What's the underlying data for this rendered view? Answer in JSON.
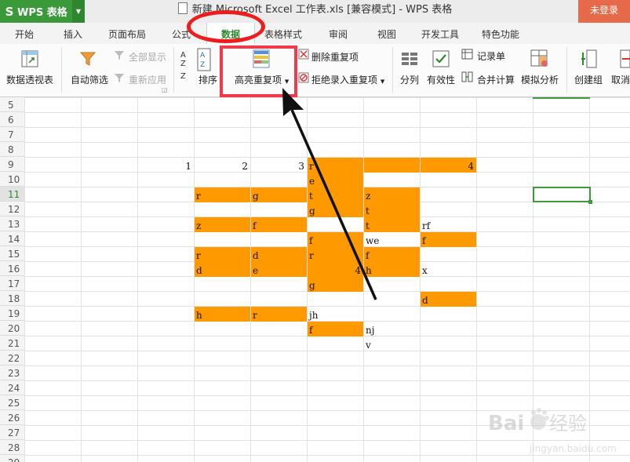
{
  "window": {
    "app_name": "WPS 表格",
    "doc_title": "新建 Microsoft Excel 工作表.xls [兼容模式] - WPS 表格",
    "login_label": "未登录"
  },
  "tabs": [
    {
      "label": "开始"
    },
    {
      "label": "插入"
    },
    {
      "label": "页面布局"
    },
    {
      "label": "公式"
    },
    {
      "label": "数据",
      "active": true
    },
    {
      "label": "表格样式"
    },
    {
      "label": "审阅"
    },
    {
      "label": "视图"
    },
    {
      "label": "开发工具"
    },
    {
      "label": "特色功能"
    }
  ],
  "ribbon": {
    "pivot": "数据透视表",
    "autofilter": "自动筛选",
    "show_all": "全部显示",
    "reapply": "重新应用",
    "sort": "排序",
    "highlight_dup": "高亮重复项",
    "delete_dup": "删除重复项",
    "reject_dup": "拒绝录入重复项",
    "split": "分列",
    "validity": "有效性",
    "record": "记录单",
    "consolidate": "合并计算",
    "simulate": "模拟分析",
    "create_group": "创建组",
    "cancel_group": "取消"
  },
  "colors": {
    "accent": "#2c8a2c",
    "fill": "#ff9900",
    "annotation_red": "#ee1c1c"
  },
  "rows": [
    "5",
    "6",
    "7",
    "8",
    "9",
    "10",
    "11",
    "12",
    "13",
    "14",
    "15",
    "16",
    "17",
    "18",
    "19",
    "20",
    "21",
    "22",
    "23",
    "24",
    "25",
    "26",
    "27",
    "28",
    "29"
  ],
  "cells": [
    {
      "r": 9,
      "c": 2,
      "v": "1",
      "align": "right"
    },
    {
      "r": 9,
      "c": 3,
      "v": "2",
      "align": "right"
    },
    {
      "r": 9,
      "c": 4,
      "v": "3",
      "align": "right"
    },
    {
      "r": 9,
      "c": 5,
      "v": "r",
      "fill": true
    },
    {
      "r": 9,
      "c": 6,
      "v": "",
      "fill": true
    },
    {
      "r": 9,
      "c": 7,
      "v": "4",
      "align": "right",
      "fill": true
    },
    {
      "r": 10,
      "c": 5,
      "v": "e",
      "fill": true
    },
    {
      "r": 11,
      "c": 3,
      "v": "r",
      "fill": true
    },
    {
      "r": 11,
      "c": 4,
      "v": "g",
      "fill": true
    },
    {
      "r": 11,
      "c": 5,
      "v": "t",
      "fill": true
    },
    {
      "r": 11,
      "c": 6,
      "v": "z",
      "fill": true
    },
    {
      "r": 12,
      "c": 5,
      "v": "g",
      "fill": true
    },
    {
      "r": 12,
      "c": 6,
      "v": "t",
      "fill": true
    },
    {
      "r": 13,
      "c": 3,
      "v": "z",
      "fill": true
    },
    {
      "r": 13,
      "c": 4,
      "v": "f",
      "fill": true
    },
    {
      "r": 13,
      "c": 6,
      "v": "t",
      "fill": true
    },
    {
      "r": 13,
      "c": 7,
      "v": "rf"
    },
    {
      "r": 14,
      "c": 5,
      "v": "f",
      "fill": true
    },
    {
      "r": 14,
      "c": 6,
      "v": "we"
    },
    {
      "r": 14,
      "c": 7,
      "v": "f",
      "fill": true
    },
    {
      "r": 15,
      "c": 3,
      "v": "r",
      "fill": true
    },
    {
      "r": 15,
      "c": 4,
      "v": "d",
      "fill": true
    },
    {
      "r": 15,
      "c": 5,
      "v": "r",
      "fill": true
    },
    {
      "r": 15,
      "c": 6,
      "v": "f",
      "fill": true
    },
    {
      "r": 16,
      "c": 3,
      "v": "d",
      "fill": true
    },
    {
      "r": 16,
      "c": 4,
      "v": "e",
      "fill": true
    },
    {
      "r": 16,
      "c": 5,
      "v": "4",
      "align": "right",
      "fill": true
    },
    {
      "r": 16,
      "c": 6,
      "v": "h",
      "fill": true
    },
    {
      "r": 16,
      "c": 7,
      "v": "x"
    },
    {
      "r": 17,
      "c": 5,
      "v": "g",
      "fill": true
    },
    {
      "r": 18,
      "c": 7,
      "v": "d",
      "fill": true
    },
    {
      "r": 19,
      "c": 3,
      "v": "h",
      "fill": true
    },
    {
      "r": 19,
      "c": 4,
      "v": "r",
      "fill": true
    },
    {
      "r": 19,
      "c": 5,
      "v": "jh"
    },
    {
      "r": 20,
      "c": 5,
      "v": "f",
      "fill": true
    },
    {
      "r": 20,
      "c": 6,
      "v": "nj"
    },
    {
      "r": 21,
      "c": 6,
      "v": "v"
    }
  ],
  "active_cell": {
    "r": 11,
    "c": 9
  },
  "watermark": {
    "brand": "Baidu经验",
    "url": "jingyan.baidu.com"
  }
}
